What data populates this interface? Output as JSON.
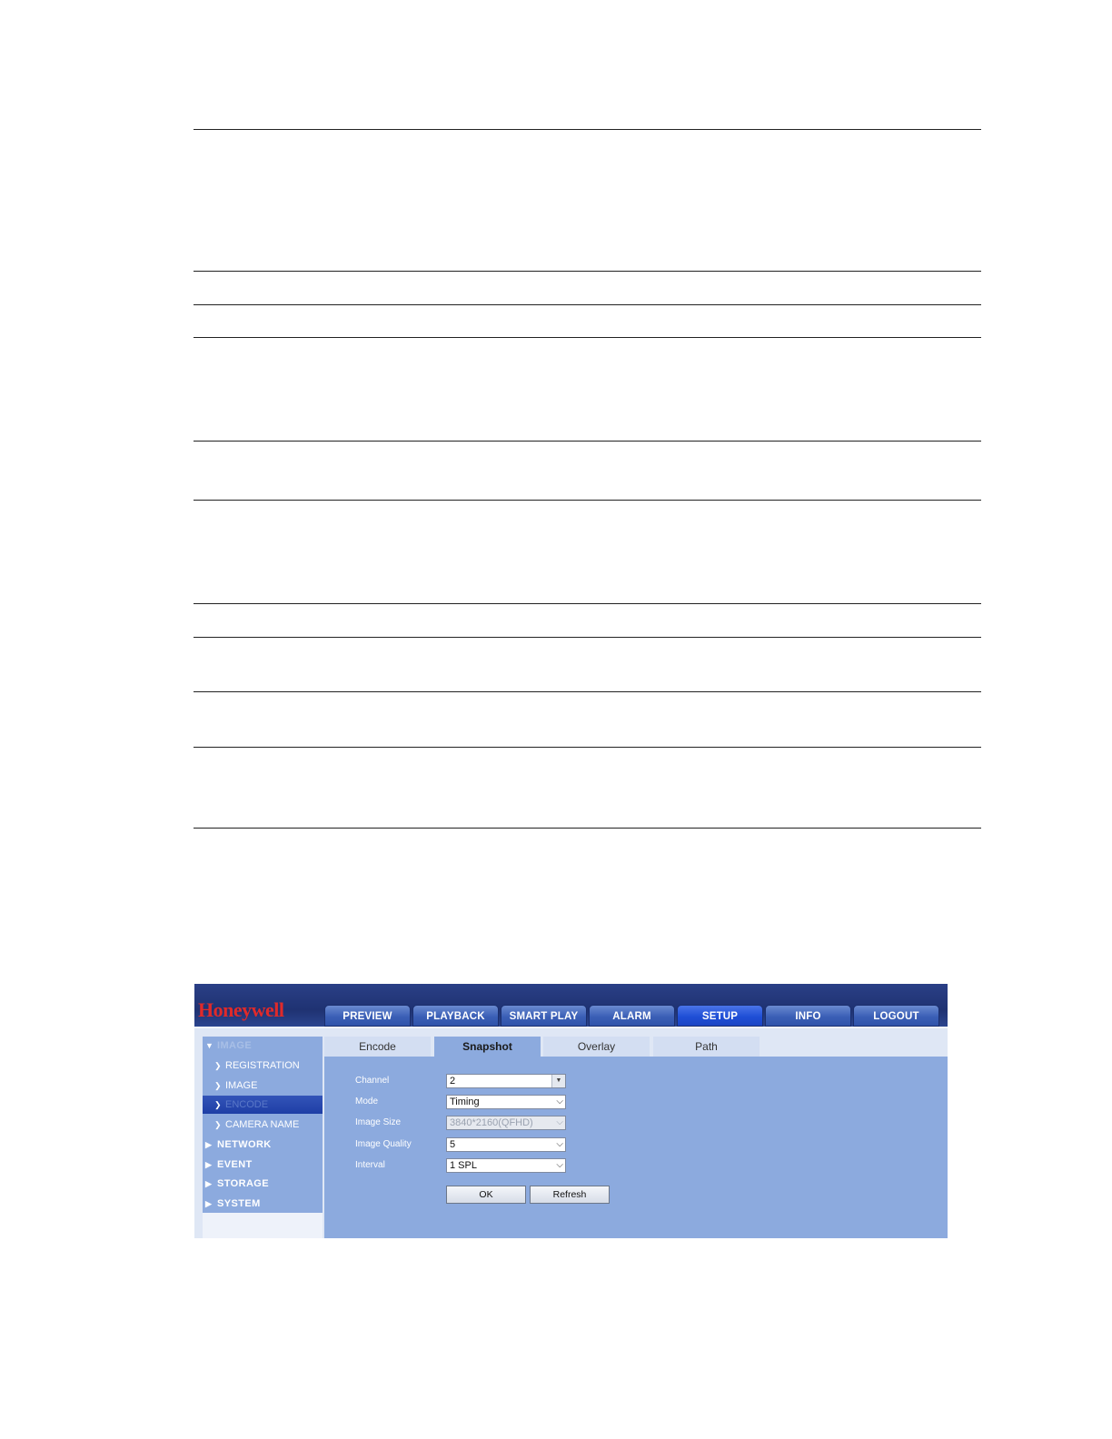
{
  "app": {
    "logo": "Honeywell"
  },
  "nav": [
    {
      "label": "PREVIEW"
    },
    {
      "label": "PLAYBACK"
    },
    {
      "label": "SMART PLAY"
    },
    {
      "label": "ALARM"
    },
    {
      "label": "SETUP",
      "active": true
    },
    {
      "label": "INFO"
    },
    {
      "label": "LOGOUT"
    }
  ],
  "sidebar": {
    "group": "IMAGE",
    "items": [
      {
        "label": "REGISTRATION"
      },
      {
        "label": "IMAGE"
      },
      {
        "label": "ENCODE",
        "selected": true
      },
      {
        "label": "CAMERA NAME"
      }
    ],
    "sections": [
      {
        "label": "NETWORK"
      },
      {
        "label": "EVENT"
      },
      {
        "label": "STORAGE"
      },
      {
        "label": "SYSTEM"
      }
    ]
  },
  "tabs": [
    {
      "label": "Encode"
    },
    {
      "label": "Snapshot",
      "active": true
    },
    {
      "label": "Overlay"
    },
    {
      "label": "Path"
    }
  ],
  "form": {
    "channel": {
      "label": "Channel",
      "value": "2"
    },
    "mode": {
      "label": "Mode",
      "value": "Timing"
    },
    "image_size": {
      "label": "Image Size",
      "value": "3840*2160(QFHD)",
      "disabled": true
    },
    "image_quality": {
      "label": "Image Quality",
      "value": "5"
    },
    "interval": {
      "label": "Interval",
      "value": "1 SPL"
    }
  },
  "buttons": {
    "ok": "OK",
    "refresh": "Refresh"
  },
  "colors": {
    "header": "#1f3272",
    "panel": "#8caade",
    "logo": "#e02a2a",
    "active_nav": "#1f4fd6"
  }
}
